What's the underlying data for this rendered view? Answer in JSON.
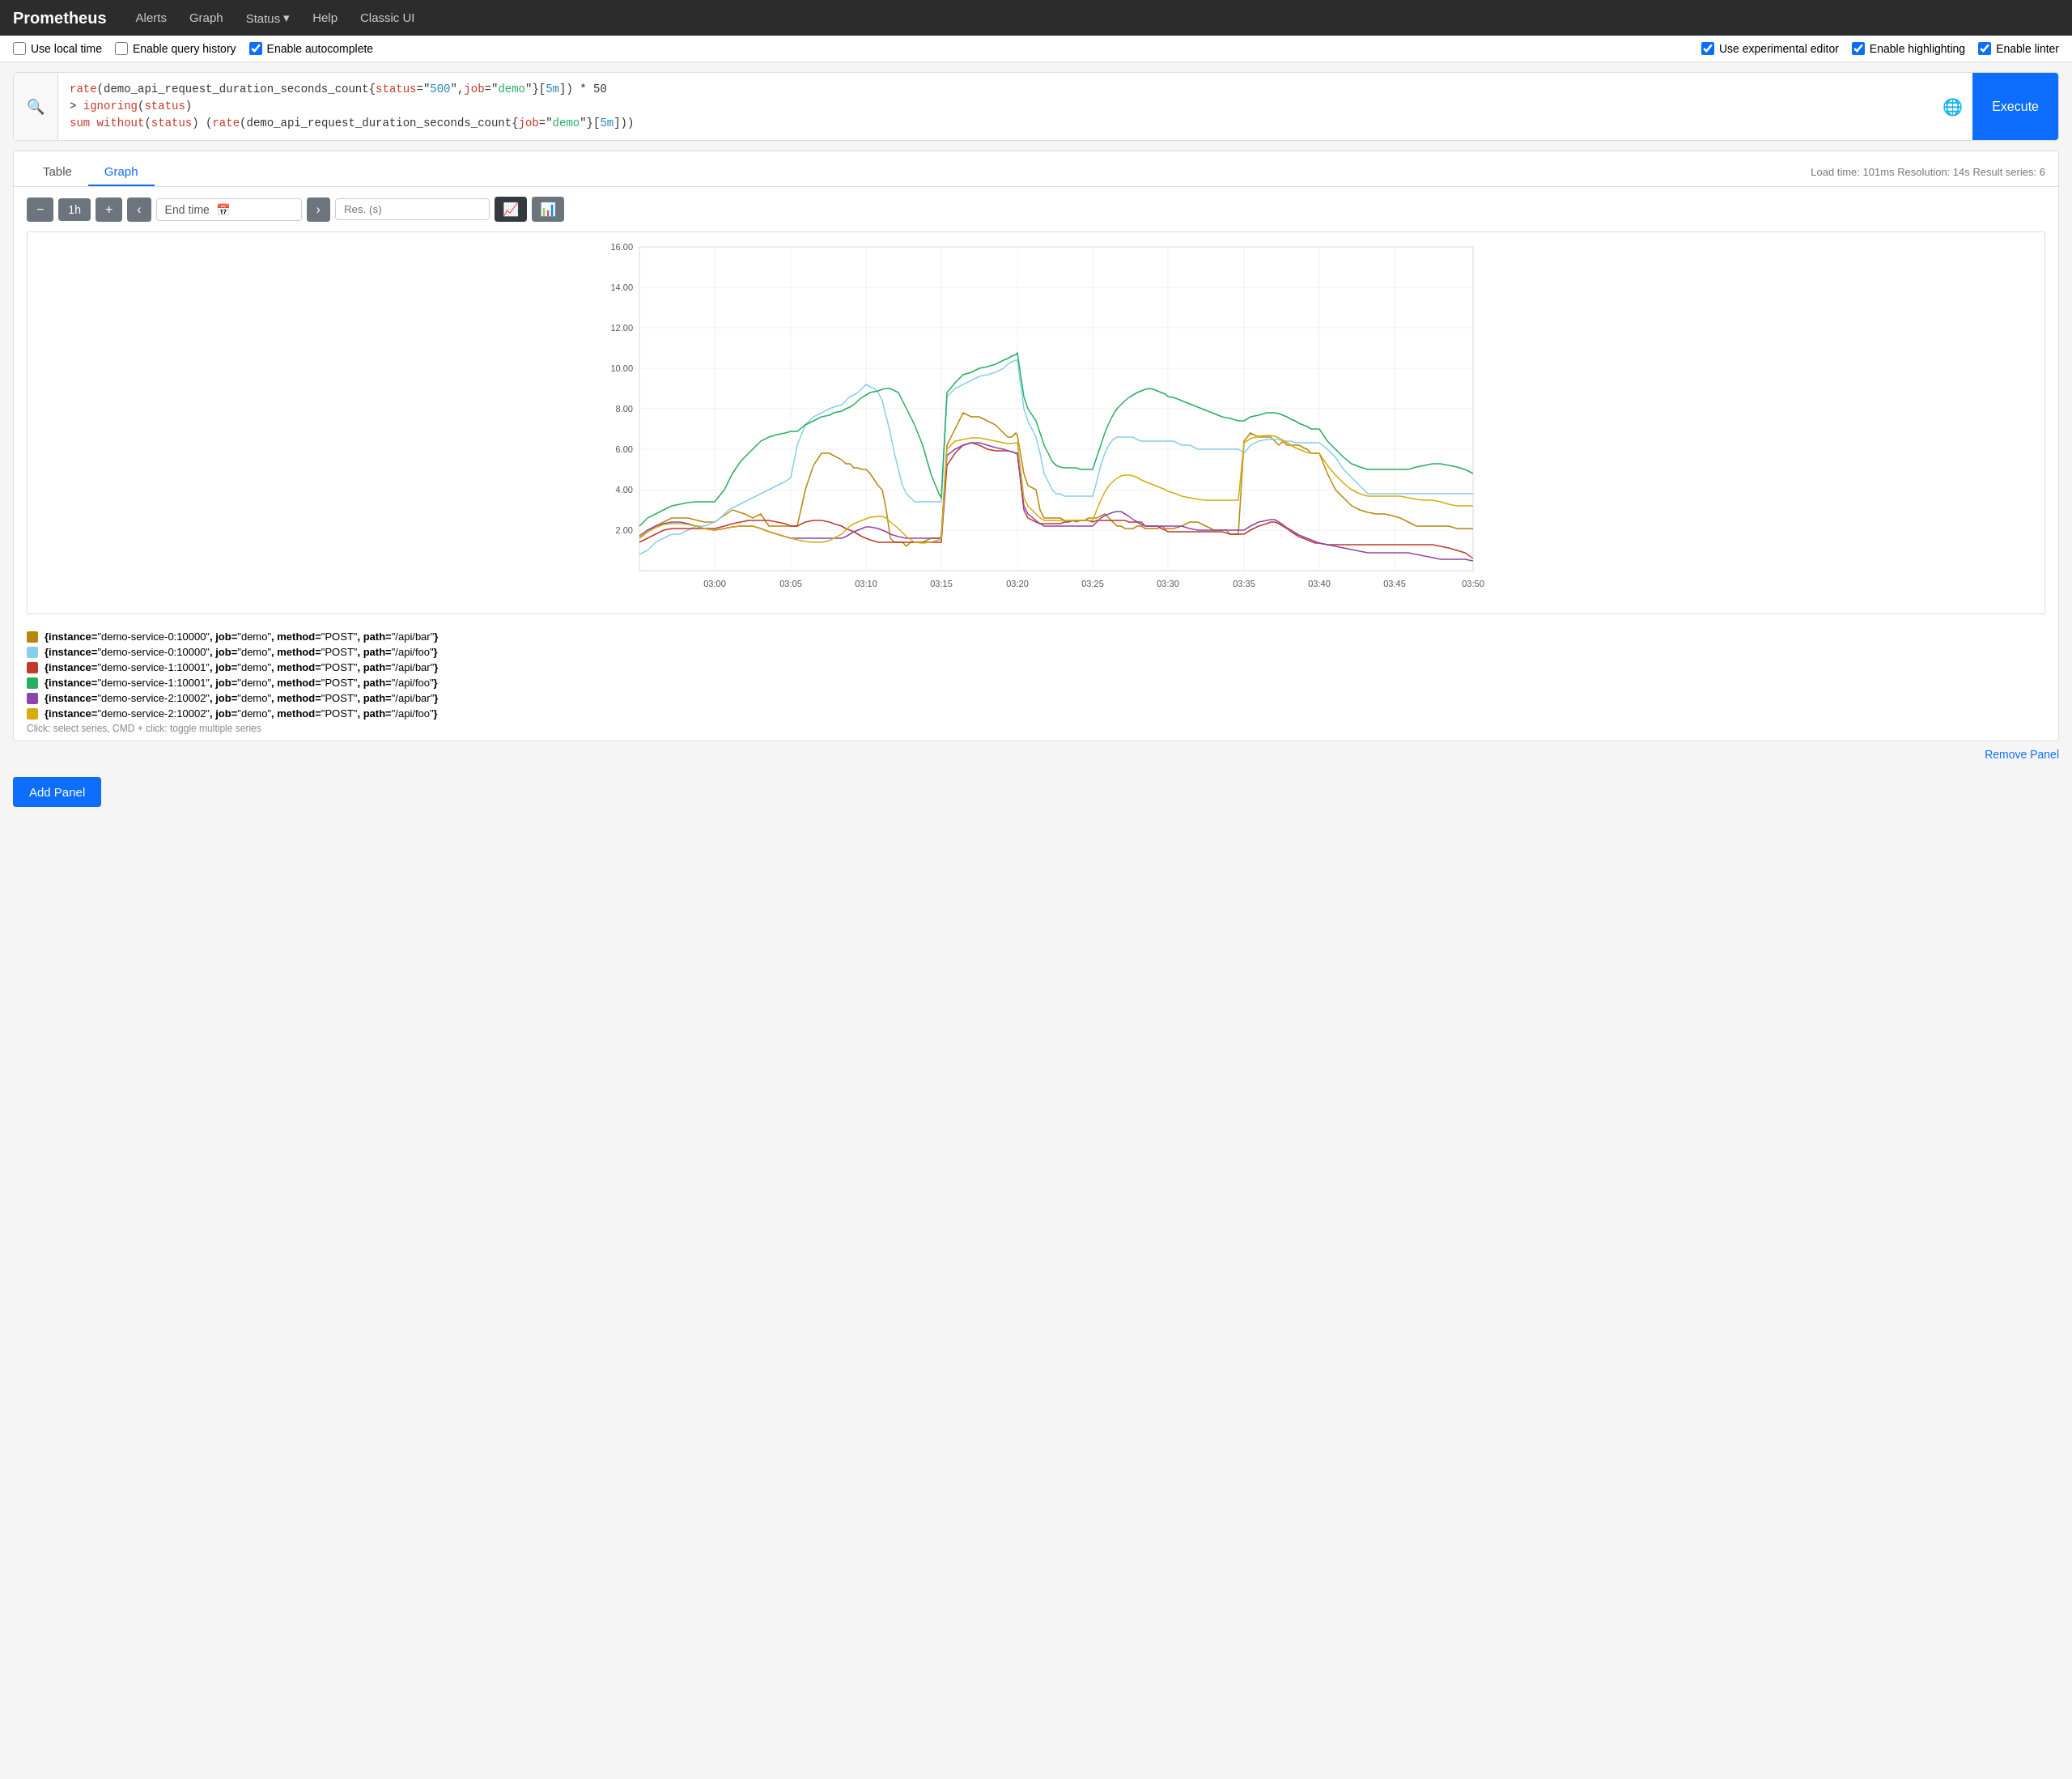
{
  "app": {
    "brand": "Prometheus"
  },
  "navbar": {
    "items": [
      {
        "label": "Alerts",
        "id": "alerts"
      },
      {
        "label": "Graph",
        "id": "graph"
      },
      {
        "label": "Status",
        "id": "status",
        "dropdown": true
      },
      {
        "label": "Help",
        "id": "help"
      },
      {
        "label": "Classic UI",
        "id": "classic-ui"
      }
    ]
  },
  "toolbar": {
    "use_local_time": {
      "label": "Use local time",
      "checked": false
    },
    "enable_query_history": {
      "label": "Enable query history",
      "checked": false
    },
    "enable_autocomplete": {
      "label": "Enable autocomplete",
      "checked": true
    },
    "use_experimental_editor": {
      "label": "Use experimental editor",
      "checked": true
    },
    "enable_highlighting": {
      "label": "Enable highlighting",
      "checked": true
    },
    "enable_linter": {
      "label": "Enable linter",
      "checked": true
    }
  },
  "query": {
    "line1": "rate(demo_api_request_duration_seconds_count{status=\"500\",job=\"demo\"}[5m]) * 50",
    "line2": "> ignoring(status)",
    "line3": "sum without(status) (rate(demo_api_request_duration_seconds_count{job=\"demo\"}[5m]))",
    "execute_label": "Execute"
  },
  "tabs": {
    "items": [
      {
        "label": "Table",
        "id": "table"
      },
      {
        "label": "Graph",
        "id": "graph",
        "active": true
      }
    ],
    "meta": "Load time: 101ms   Resolution: 14s   Result series: 6"
  },
  "graph_controls": {
    "minus_label": "−",
    "range_label": "1h",
    "plus_label": "+",
    "prev_label": "‹",
    "end_time_placeholder": "End time",
    "next_label": "›",
    "res_placeholder": "Res. (s)",
    "chart_line_label": "📈",
    "chart_bar_label": "📊"
  },
  "chart": {
    "y_labels": [
      "16.00",
      "14.00",
      "12.00",
      "10.00",
      "8.00",
      "6.00",
      "4.00",
      "2.00"
    ],
    "x_labels": [
      "03:00",
      "03:05",
      "03:10",
      "03:15",
      "03:20",
      "03:25",
      "03:30",
      "03:35",
      "03:40",
      "03:45",
      "03:50"
    ]
  },
  "legend": {
    "items": [
      {
        "color": "#b8860b",
        "text": "{instance=\"demo-service-0:10000\", job=\"demo\", method=\"POST\", path=\"/api/bar\"}"
      },
      {
        "color": "#87ceeb",
        "text": "{instance=\"demo-service-0:10000\", job=\"demo\", method=\"POST\", path=\"/api/foo\"}"
      },
      {
        "color": "#c0392b",
        "text": "{instance=\"demo-service-1:10001\", job=\"demo\", method=\"POST\", path=\"/api/bar\"}"
      },
      {
        "color": "#27ae60",
        "text": "{instance=\"demo-service-1:10001\", job=\"demo\", method=\"POST\", path=\"/api/foo\"}"
      },
      {
        "color": "#8e44ad",
        "text": "{instance=\"demo-service-2:10002\", job=\"demo\", method=\"POST\", path=\"/api/bar\"}"
      },
      {
        "color": "#d4ac0d",
        "text": "{instance=\"demo-service-2:10002\", job=\"demo\", method=\"POST\", path=\"/api/foo\"}"
      }
    ],
    "hint": "Click: select series, CMD + click: toggle multiple series"
  },
  "footer": {
    "remove_panel_label": "Remove Panel",
    "add_panel_label": "Add Panel"
  }
}
